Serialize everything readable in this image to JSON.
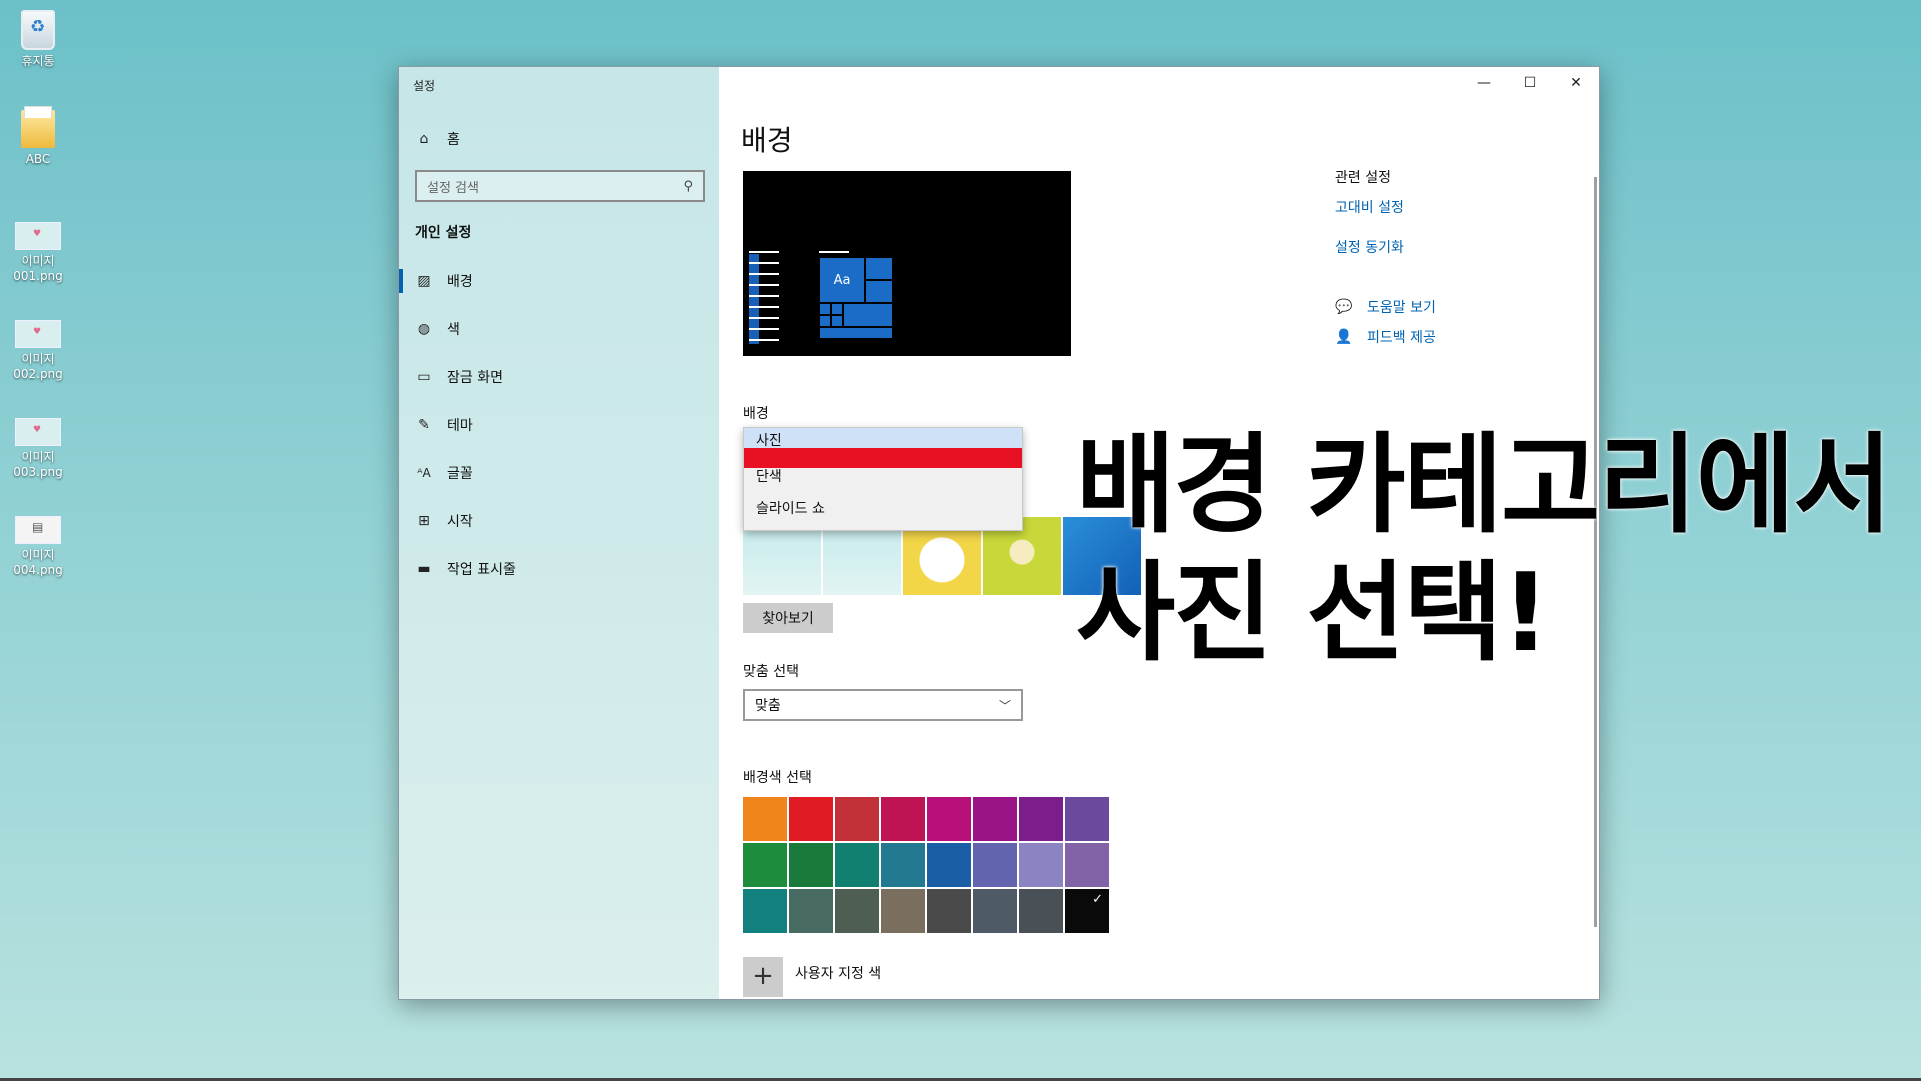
{
  "desktop": {
    "icons": [
      {
        "label": "휴지통",
        "icon": "recycle-bin-icon"
      },
      {
        "label": "ABC",
        "icon": "folder-icon"
      },
      {
        "label": "이미지\n001.png",
        "icon": "image-file-icon"
      },
      {
        "label": "이미지\n002.png",
        "icon": "image-file-icon"
      },
      {
        "label": "이미지\n003.png",
        "icon": "image-file-icon"
      },
      {
        "label": "이미지\n004.png",
        "icon": "image-file-icon"
      }
    ]
  },
  "window": {
    "title": "설정",
    "caption": {
      "minimize": "—",
      "maximize": "☐",
      "close": "✕"
    }
  },
  "sidebar": {
    "home_label": "홈",
    "search_placeholder": "설정 검색",
    "group_title": "개인 설정",
    "items": [
      {
        "label": "배경",
        "icon": "image-icon",
        "active": true
      },
      {
        "label": "색",
        "icon": "palette-icon",
        "active": false
      },
      {
        "label": "잠금 화면",
        "icon": "lock-screen-icon",
        "active": false
      },
      {
        "label": "테마",
        "icon": "theme-brush-icon",
        "active": false
      },
      {
        "label": "글꼴",
        "icon": "font-icon",
        "active": false
      },
      {
        "label": "시작",
        "icon": "start-grid-icon",
        "active": false
      },
      {
        "label": "작업 표시줄",
        "icon": "taskbar-icon",
        "active": false
      }
    ]
  },
  "main": {
    "title": "배경",
    "preview": {
      "tile_text": "Aa"
    },
    "background_label": "배경",
    "background_options": [
      "사진",
      "단색",
      "슬라이드 쇼"
    ],
    "background_selected": "사진",
    "browse_button": "찾아보기",
    "fit_label": "맞춤 선택",
    "fit_value": "맞춤",
    "color_label": "배경색 선택",
    "colors": [
      "#f0861b",
      "#e01b24",
      "#c2303a",
      "#bf1453",
      "#b8107a",
      "#9a1487",
      "#7b1e8c",
      "#6b4a9e",
      "#1d8c3c",
      "#1a7a3c",
      "#128070",
      "#23798f",
      "#1a5ea6",
      "#6264ad",
      "#8a85c2",
      "#8263a8",
      "#12807e",
      "#476a63",
      "#4f5e52",
      "#7a6e5e",
      "#4b4a4a",
      "#4e5a66",
      "#4a5156",
      "#0a0a0a"
    ],
    "selected_color": "#0a0a0a",
    "custom_color_label": "사용자 지정 색"
  },
  "related": {
    "heading": "관련 설정",
    "links": [
      "고대비 설정",
      "설정 동기화"
    ],
    "help": [
      {
        "label": "도움말 보기",
        "icon": "help-chat-icon"
      },
      {
        "label": "피드백 제공",
        "icon": "feedback-icon"
      }
    ]
  },
  "overlay": {
    "line1": "배경 카테고리에서",
    "line2": "사진 선택!"
  }
}
